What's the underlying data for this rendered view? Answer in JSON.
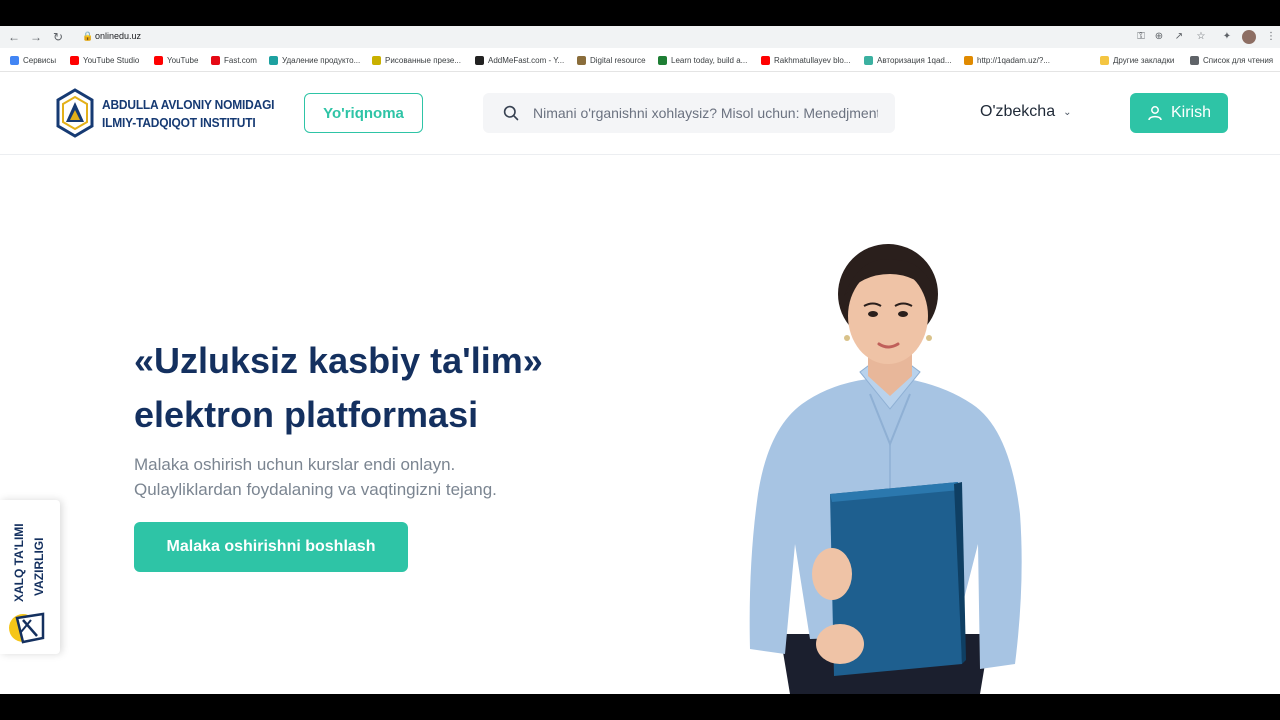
{
  "browser": {
    "url": "onlinedu.uz",
    "bookmarks": [
      {
        "label": "Сервисы",
        "color": "#4285f4"
      },
      {
        "label": "YouTube Studio",
        "color": "#ff0000"
      },
      {
        "label": "YouTube",
        "color": "#ff0000"
      },
      {
        "label": "Fast.com",
        "color": "#e50914"
      },
      {
        "label": "Удаление продукто...",
        "color": "#1da1a0"
      },
      {
        "label": "Рисованные презе...",
        "color": "#c9b000"
      },
      {
        "label": "AddMeFast.com - Y...",
        "color": "#222222"
      },
      {
        "label": "Digital resource",
        "color": "#8a6d3b"
      },
      {
        "label": "Learn today, build a...",
        "color": "#1e7e34"
      },
      {
        "label": "Rakhmatullayev blo...",
        "color": "#ff0000"
      },
      {
        "label": "Авторизация 1qad...",
        "color": "#3bb0a0"
      },
      {
        "label": "http://1qadam.uz/?...",
        "color": "#e08a00"
      },
      {
        "label": "Другие закладки",
        "color": "#f4c542"
      },
      {
        "label": "Список для чтения",
        "color": "#5f6368"
      }
    ]
  },
  "header": {
    "logo_line1": "ABDULLA AVLONIY NOMIDAGI",
    "logo_line2": "ILMIY-TADQIQOT INSTITUTI",
    "guide_label": "Yo'riqnoma",
    "search_placeholder": "Nimani o'rganishni xohlaysiz? Misol uchun: Menedjment",
    "language": "O'zbekcha",
    "login_label": "Kirish"
  },
  "hero": {
    "title_line1": "«Uzluksiz kasbiy ta'lim»",
    "title_line2": "elektron platformasi",
    "subtitle_line1": "Malaka oshirish uchun kurslar endi onlayn.",
    "subtitle_line2": "Qulayliklardan foydalaning va vaqtingizni tejang.",
    "cta_label": "Malaka oshirishni boshlash"
  },
  "ministry": {
    "line1": "XALQ TA'LIMI",
    "line2": "VAZIRLIGI"
  },
  "colors": {
    "accent": "#2ec4a6",
    "navy": "#14305f",
    "muted": "#7b8591"
  }
}
